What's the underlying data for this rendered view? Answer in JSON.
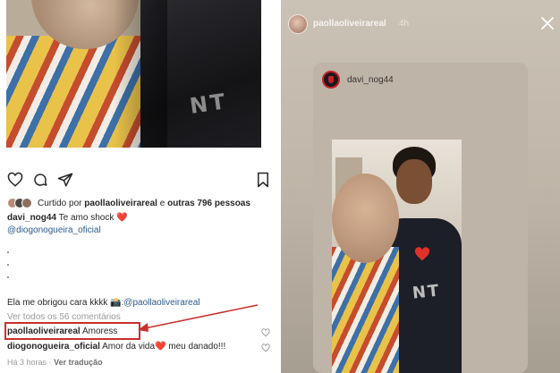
{
  "feed_post": {
    "liked_by_prefix": "Curtido por ",
    "liked_by_user": "paollaoliveirareal",
    "liked_by_join": " e ",
    "liked_by_others": "outras 796 pessoas",
    "photo_print_text": "NT",
    "caption": {
      "username": "davi_nog44",
      "text": "Te amo shock",
      "emoji": "❤️",
      "mention": "@diogonogueira_oficial",
      "dots": [
        ".",
        ".",
        "."
      ],
      "line2_text": "Ela me obrigou cara kkkk",
      "line2_emoji": "📸",
      "line2_mention": ":@paollaoliveirareal"
    },
    "view_all_comments": "Ver todos os 56 comentários",
    "comments": [
      {
        "username": "paollaoliveirareal",
        "text": "Amoress"
      },
      {
        "username": "diogonogueira_oficial",
        "text": "Amor da vida",
        "emoji": "❤️",
        "text_after": " meu danado!!!"
      }
    ],
    "footer": {
      "time": "Há 3 horas",
      "separator": "·",
      "translate": "Ver tradução"
    },
    "colors": {
      "highlight": "#c8302c",
      "mention": "#2a5a8a",
      "heart": "#e0312b"
    }
  },
  "story": {
    "username": "paollaoliveirareal",
    "time": "4h",
    "shared_from": "davi_nog44",
    "photo_print_text": "NT",
    "colors": {
      "background": "#c4bbaf"
    }
  }
}
